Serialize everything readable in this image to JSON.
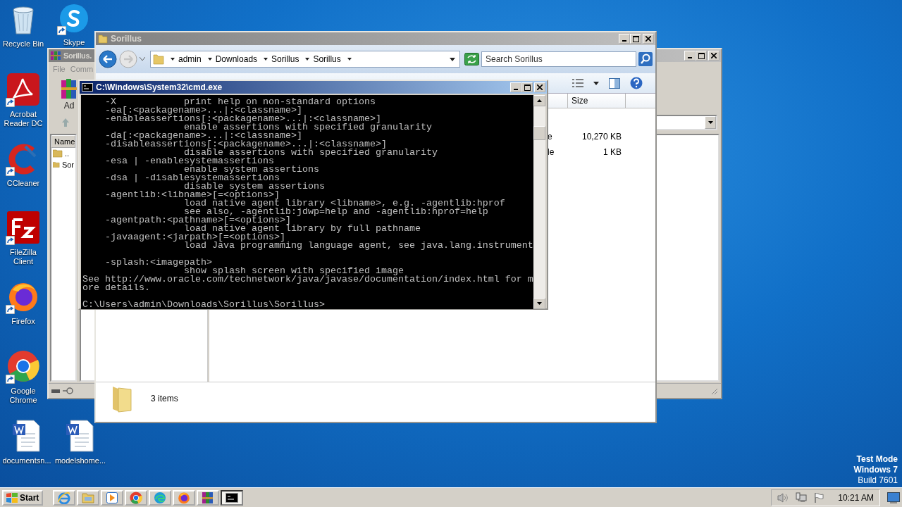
{
  "desktop_icons": [
    {
      "kind": "recycle-bin",
      "label": "Recycle Bin",
      "shortcut": false
    },
    {
      "kind": "skype",
      "label": "Skype",
      "shortcut": true
    },
    {
      "kind": "acrobat",
      "label": "Acrobat Reader DC",
      "shortcut": true
    },
    {
      "kind": "ccleaner",
      "label": "CCleaner",
      "shortcut": true
    },
    {
      "kind": "filezilla",
      "label": "FileZilla Client",
      "shortcut": true
    },
    {
      "kind": "firefox",
      "label": "Firefox",
      "shortcut": true
    },
    {
      "kind": "chrome",
      "label": "Google Chrome",
      "shortcut": true
    },
    {
      "kind": "word",
      "label": "documentsn...",
      "shortcut": false
    },
    {
      "kind": "word",
      "label": "modelshome...",
      "shortcut": false
    }
  ],
  "edition_notice": [
    "Test Mode",
    "Windows 7",
    "Build 7601"
  ],
  "winrar_window": {
    "title": "Sorillus.",
    "menu": [
      "File",
      "Comm"
    ],
    "toolbar_label": "Ad",
    "column_header": "Name",
    "rows": [
      "..",
      "Sor"
    ]
  },
  "explorer_window": {
    "title": "Sorillus",
    "breadcrumb": [
      "admin",
      "Downloads",
      "Sorillus",
      "Sorillus"
    ],
    "search": {
      "placeholder": "Search Sorillus"
    },
    "column_header": "Size",
    "rows": [
      {
        "column_type": "e",
        "size": "10,270 KB"
      },
      {
        "column_type": "le",
        "size": "1 KB"
      }
    ],
    "status": "3 items"
  },
  "cmd_window": {
    "title": "C:\\Windows\\System32\\cmd.exe",
    "blocks": [
      [
        "    -X            print help on non-standard options",
        "    -ea[:<packagename>...|:<classname>]",
        "    -enableassertions[:<packagename>...|:<classname>]",
        "                  enable assertions with specified granularity",
        "    -da[:<packagename>...|:<classname>]",
        "    -disableassertions[:<packagename>...|:<classname>]",
        "                  disable assertions with specified granularity",
        "    -esa | -enablesystemassertions",
        "                  enable system assertions",
        "    -dsa | -disablesystemassertions",
        "                  disable system assertions",
        "    -agentlib:<libname>[=<options>]",
        "                  load native agent library <libname>, e.g. -agentlib:hprof",
        "                  see also, -agentlib:jdwp=help and -agentlib:hprof=help",
        "    -agentpath:<pathname>[=<options>]",
        "                  load native agent library by full pathname",
        "    -javaagent:<jarpath>[=<options>]",
        "                  load Java programming language agent, see java.lang.instrument"
      ],
      [
        "    -splash:<imagepath>",
        "                  show splash screen with specified image",
        "See http://www.oracle.com/technetwork/java/javase/documentation/index.html for m",
        "ore details."
      ],
      [
        "C:\\Users\\admin\\Downloads\\Sorillus\\Sorillus>"
      ]
    ]
  },
  "taskbar": {
    "start": "Start",
    "apps": [
      {
        "kind": "ie",
        "selected": false
      },
      {
        "kind": "explorer",
        "selected": false
      },
      {
        "kind": "media-player",
        "selected": false
      },
      {
        "kind": "chrome",
        "selected": false
      },
      {
        "kind": "edge",
        "selected": false
      },
      {
        "kind": "firefox",
        "selected": false
      },
      {
        "kind": "winrar",
        "selected": false
      },
      {
        "kind": "cmd",
        "selected": true
      }
    ],
    "clock": "10:21 AM"
  }
}
